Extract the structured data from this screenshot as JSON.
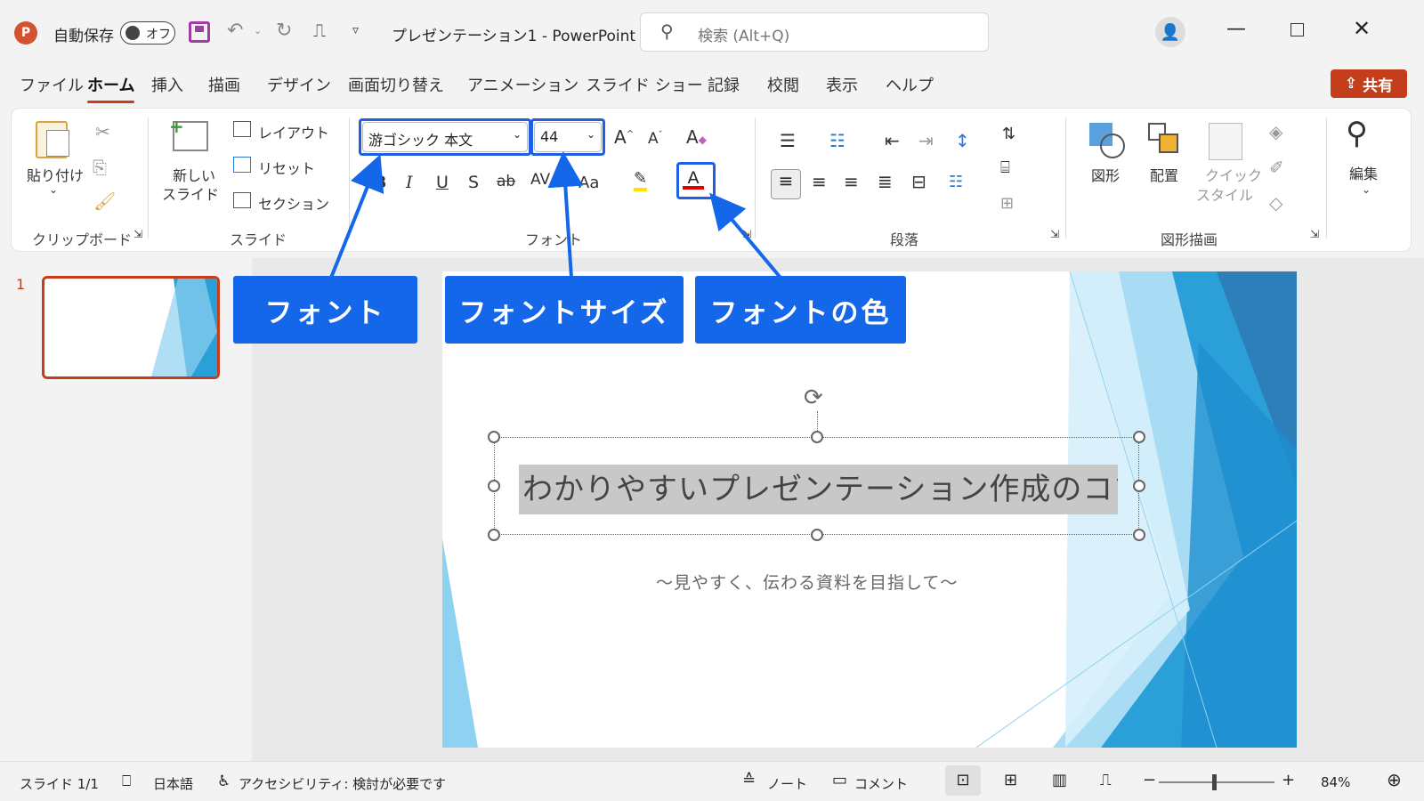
{
  "app": {
    "autosave_label": "自動保存",
    "autosave_state": "オフ",
    "doc_title": "プレゼンテーション1  -  PowerPoint",
    "search_placeholder": "検索 (Alt+Q)",
    "share": "共有"
  },
  "tabs": [
    "ファイル",
    "ホーム",
    "挿入",
    "描画",
    "デザイン",
    "画面切り替え",
    "アニメーション",
    "スライド ショー",
    "記録",
    "校閲",
    "表示",
    "ヘルプ"
  ],
  "ribbon": {
    "clipboard": {
      "paste": "貼り付け",
      "group": "クリップボード"
    },
    "slides": {
      "new_slide_1": "新しい",
      "new_slide_2": "スライド",
      "layout": "レイアウト",
      "reset": "リセット",
      "section": "セクション",
      "group": "スライド"
    },
    "font": {
      "font_name": "游ゴシック 本文",
      "font_size": "44",
      "case": "Aa",
      "group": "フォント"
    },
    "paragraph": {
      "group": "段落"
    },
    "drawing": {
      "shapes": "図形",
      "arrange": "配置",
      "quick_1": "クイック",
      "quick_2": "スタイル",
      "group": "図形描画"
    },
    "editing": {
      "label": "編集"
    }
  },
  "callouts": {
    "font": "フォント",
    "font_size": "フォントサイズ",
    "font_color": "フォントの色"
  },
  "thumbnail": {
    "number": "1"
  },
  "slide": {
    "title": "わかりやすいプレゼンテーション作成のコツ",
    "subtitle": "～見やすく、伝わる資料を目指して～"
  },
  "status": {
    "slide_count": "スライド 1/1",
    "language": "日本語",
    "accessibility": "アクセシビリティ: 検討が必要です",
    "notes": "ノート",
    "comments": "コメント",
    "zoom": "84%"
  },
  "colors": {
    "accent": "#c43e1c",
    "callout": "#1567ea",
    "slide_blue": "#2a9fd8"
  }
}
